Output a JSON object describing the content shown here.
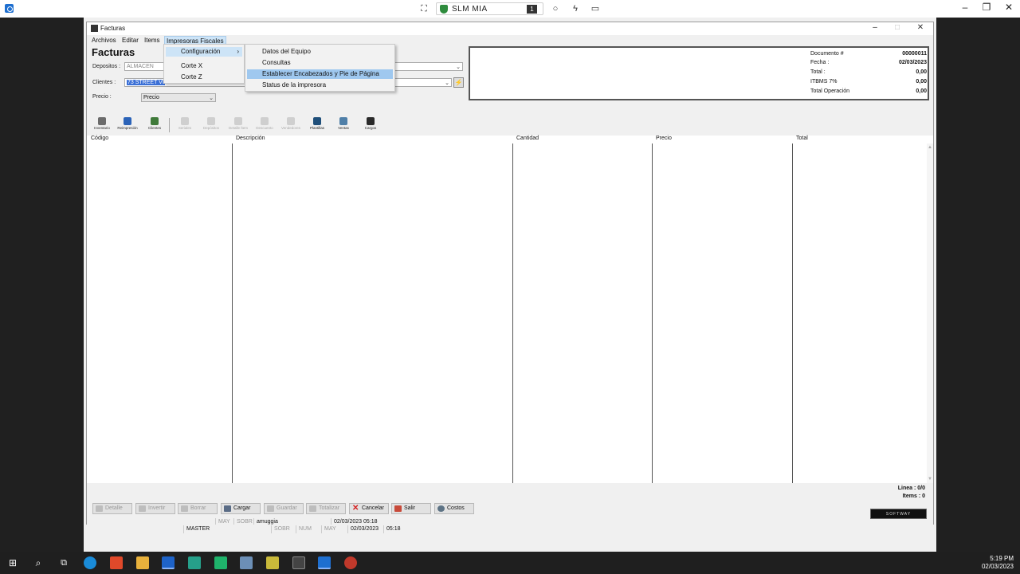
{
  "remote_bar": {
    "session_name": "SLM MIA",
    "session_number": "1"
  },
  "window": {
    "title": "Facturas"
  },
  "menubar": {
    "items": [
      "Archivos",
      "Editar",
      "Items",
      "Impresoras Fiscales"
    ]
  },
  "form": {
    "heading": "Facturas",
    "depositos_label": "Depositos :",
    "depositos_value": "ALMACEN",
    "clientes_label": "Clientes :",
    "clientes_value": "73 STREET VI",
    "precio_label": "Precio :",
    "precio_value": "Precio"
  },
  "info": {
    "documento_label": "Documento #",
    "documento_value": "00000011",
    "fecha_label": "Fecha :",
    "fecha_value": "02/03/2023",
    "total_label": "Total :",
    "total_value": "0,00",
    "itbms_label": "ITBMS 7%",
    "itbms_value": "0,00",
    "total_op_label": "Total Operación",
    "total_op_value": "0,00"
  },
  "toolbar": {
    "items": [
      "Inventario",
      "Reimpresión",
      "Clientes",
      "Seriales",
      "Depósitos",
      "Detalle Ítem",
      "Descuento",
      "Vendedores",
      "Plantillas",
      "Ventas",
      "Cargos"
    ]
  },
  "grid": {
    "columns": [
      "Código",
      "Descripción",
      "Cantidad",
      "Precio",
      "Total"
    ]
  },
  "summary": {
    "linea": "Linea : 0/0",
    "items": "Items : 0"
  },
  "buttons": {
    "detalle": "Detalle",
    "invertir": "Invertir",
    "borrar": "Borrar",
    "cargar": "Cargar",
    "guardar": "Guardar",
    "totalizar": "Totalizar",
    "cancelar": "Cancelar",
    "salir": "Salir",
    "costos": "Costos"
  },
  "window_status": {
    "may": "MAY",
    "sobr": "SOBR",
    "user": "amuggia",
    "datetime": "02/03/2023 05:18"
  },
  "outer_status": {
    "master": "MASTER",
    "sobr": "SOBR",
    "num": "NUM",
    "may": "MAY",
    "date": "02/03/2023",
    "time": "05:18"
  },
  "menu_impresoras": {
    "items": [
      "Configuración",
      "Corte X",
      "Corte Z"
    ]
  },
  "menu_configuracion": {
    "items": [
      "Datos del Equipo",
      "Consultas",
      "Establecer Encabezados y Pie de Página",
      "Status de la impresora"
    ]
  },
  "logo_text": "SOFTWAY",
  "taskbar": {
    "time": "5:19 PM",
    "date": "02/03/2023"
  },
  "colors": {
    "menu_highlight": "#cde4f7",
    "selection": "#3a6fd6",
    "cancel_red": "#d42020"
  }
}
